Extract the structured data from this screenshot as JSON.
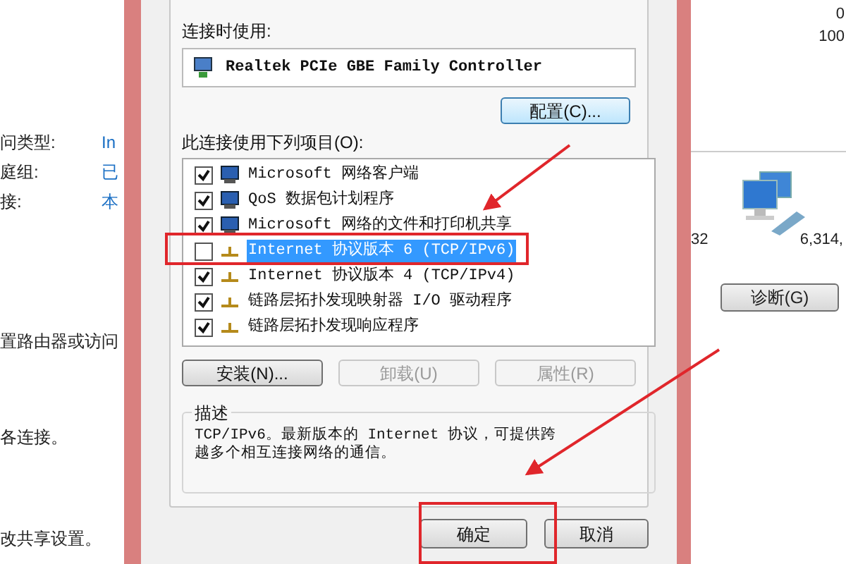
{
  "left_window": {
    "fields": [
      {
        "label": "问类型:",
        "value": "In"
      },
      {
        "label": "庭组:",
        "value": "已"
      },
      {
        "label": "接:",
        "value": "本"
      }
    ],
    "texts": [
      "置路由器或访问",
      "各连接。",
      "改共享设置。"
    ]
  },
  "dialog": {
    "connect_using_label": "连接时使用:",
    "adapter": "Realtek PCIe GBE Family Controller",
    "configure_button": "配置(C)...",
    "items_label": "此连接使用下列项目(O):",
    "items": [
      {
        "label": "Microsoft 网络客户端",
        "checked": true,
        "selected": false,
        "kind": "computer"
      },
      {
        "label": "QoS 数据包计划程序",
        "checked": true,
        "selected": false,
        "kind": "computer"
      },
      {
        "label": "Microsoft 网络的文件和打印机共享",
        "checked": true,
        "selected": false,
        "kind": "computer"
      },
      {
        "label": "Internet 协议版本 6 (TCP/IPv6)",
        "checked": false,
        "selected": true,
        "kind": "protocol"
      },
      {
        "label": "Internet 协议版本 4 (TCP/IPv4)",
        "checked": true,
        "selected": false,
        "kind": "protocol"
      },
      {
        "label": "链路层拓扑发现映射器 I/O 驱动程序",
        "checked": true,
        "selected": false,
        "kind": "protocol"
      },
      {
        "label": "链路层拓扑发现响应程序",
        "checked": true,
        "selected": false,
        "kind": "protocol"
      }
    ],
    "buttons": [
      {
        "label": "安装(N)...",
        "disabled": false
      },
      {
        "label": "卸载(U)",
        "disabled": true
      },
      {
        "label": "属性(R)",
        "disabled": true
      }
    ],
    "description_title": "描述",
    "description": "TCP/IPv6。最新版本的 Internet 协议，可提供跨越多个相互连接网络的通信。",
    "ok_button": "确定",
    "cancel_button": "取消"
  },
  "right_window": {
    "texts": [
      "0",
      "100"
    ],
    "stats": [
      "32",
      "6,314,"
    ],
    "diagnose_button": "诊断(G)"
  }
}
